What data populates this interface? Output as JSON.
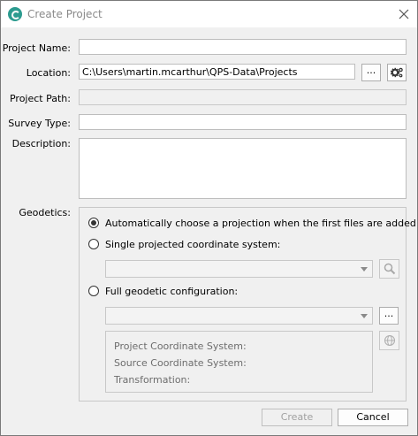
{
  "window": {
    "title": "Create Project"
  },
  "form": {
    "project_name": {
      "label": "Project Name:",
      "value": ""
    },
    "location": {
      "label": "Location:",
      "value": "C:\\Users\\martin.mcarthur\\QPS-Data\\Projects",
      "browse_label": "..."
    },
    "project_path": {
      "label": "Project Path:",
      "value": ""
    },
    "survey_type": {
      "label": "Survey Type:",
      "value": ""
    },
    "description": {
      "label": "Description:",
      "value": ""
    }
  },
  "geodetics": {
    "label": "Geodetics:",
    "options": [
      {
        "label": "Automatically choose a projection when the first files are added",
        "selected": true
      },
      {
        "label": "Single projected coordinate system:",
        "selected": false
      },
      {
        "label": "Full geodetic configuration:",
        "selected": false
      }
    ],
    "projected_cs_value": "",
    "geodetic_config_value": "",
    "config_browse_label": "...",
    "info": {
      "project_cs": "Project Coordinate System:",
      "source_cs": "Source Coordinate System:",
      "transformation": "Transformation:"
    }
  },
  "buttons": {
    "create": "Create",
    "cancel": "Cancel"
  },
  "colors": {
    "app_icon": "#2c9b8f",
    "dialog_bg": "#f0f0f0",
    "disabled_text": "#a0a0a0"
  }
}
